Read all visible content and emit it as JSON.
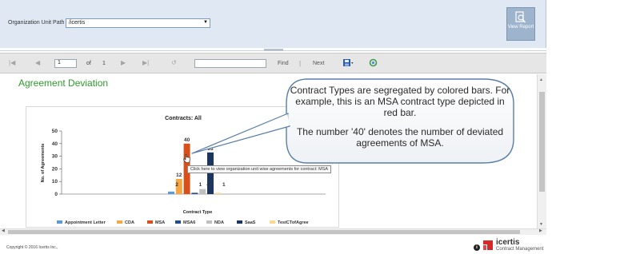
{
  "params": {
    "org_label": "Organization Unit Path",
    "org_value": "/icertis",
    "view_report_label": "View Report"
  },
  "toolbar": {
    "page_current": "1",
    "of_label": "of",
    "page_total": "1",
    "find_label": "Find",
    "separator": "|",
    "next_label": "Next"
  },
  "report": {
    "title": "Agreement Deviation"
  },
  "chart_data": {
    "type": "bar",
    "title": "Contracts: All",
    "xlabel": "Contract Type",
    "ylabel": "No. of Agreements",
    "ylim": [
      0,
      50
    ],
    "yticks": [
      "0",
      "10",
      "20",
      "30",
      "40",
      "50"
    ],
    "grid": false,
    "legend_position": "bottom",
    "series": [
      {
        "name": "Appointment Letter",
        "color": "#5b9bd5",
        "value": 2,
        "label": "2"
      },
      {
        "name": "CDA",
        "color": "#f4a742",
        "value": 12,
        "label": "12"
      },
      {
        "name": "MSA",
        "color": "#d94f1a",
        "value": 40,
        "label": "40"
      },
      {
        "name": "MSA6",
        "color": "#1f4e8c",
        "value": 1,
        "label": "1"
      },
      {
        "name": "NDA",
        "color": "#bfbfbf",
        "value": 4,
        "label": "4"
      },
      {
        "name": "SaaS",
        "color": "#1a3560",
        "value": 33,
        "label": "33"
      },
      {
        "name": "TestCTofAgree",
        "color": "#ffd98a",
        "value": 1,
        "label": "1"
      }
    ],
    "tooltip": "Click here to view organization unit wise agreements for contract: MSA"
  },
  "callout": {
    "line1": "Contract Types are segregated by colored bars. For example, this is an MSA contract type depicted in red bar.",
    "line2": "The number '40' denotes the number of deviated agreements of MSA."
  },
  "footer": {
    "copyright": "Copyright © 2016 Icertis Inc.,",
    "brand": "icertis",
    "tagline": "Contract Management",
    "info": "i"
  }
}
